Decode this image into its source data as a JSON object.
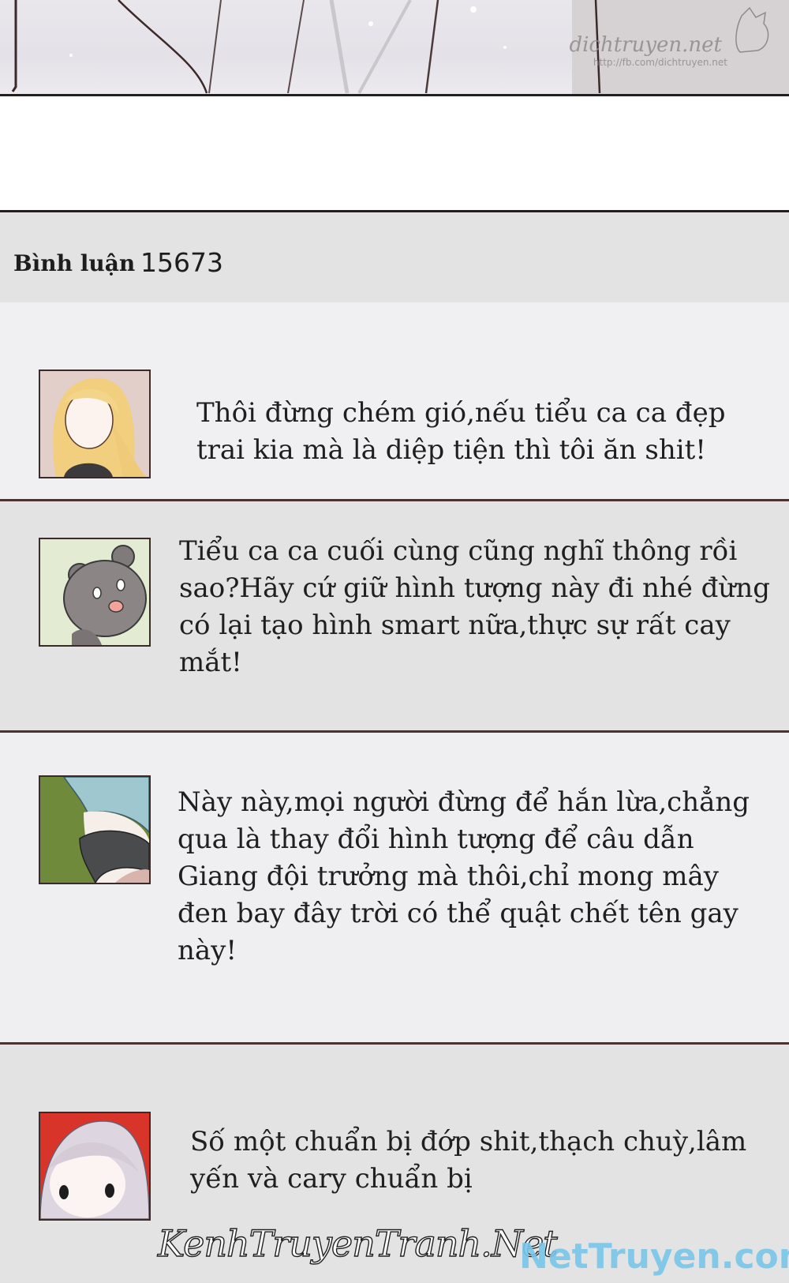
{
  "top_panel": {
    "watermark_title": "dichtruyen.net",
    "watermark_url": "http://fb.com/dichtruyen.net"
  },
  "comments_header": {
    "label": "Bình luận",
    "count": "15673"
  },
  "comments": [
    {
      "avatar_icon": "blonde-girl-avatar-icon",
      "text": "Thôi đừng chém gió,nếu tiểu ca ca đẹp trai kia mà là diệp tiện thì tôi ăn shit!"
    },
    {
      "avatar_icon": "bear-avatar-icon",
      "text": "Tiểu ca ca cuối cùng cũng nghĩ thông rồi sao?Hãy cứ giữ hình tượng này đi nhé đừng có lại tạo hình smart nữa,thực sự rất cay mắt!"
    },
    {
      "avatar_icon": "blue-hair-scarf-avatar-icon",
      "text": "Này này,mọi người đừng để hắn lừa,chẳng qua là thay đổi hình tượng để câu dẫn Giang đội trưởng mà thôi,chỉ mong mây đen bay đây trời có thể quật chết tên gay này!"
    },
    {
      "avatar_icon": "silver-hair-girl-avatar-icon",
      "text": "Số một chuẩn bị đớp shit,thạch chuỳ,lâm yến và cary chuẩn bị"
    }
  ],
  "footer": {
    "watermark_left": "KenhTruyenTranh.Net",
    "watermark_right": "NetTruyen.com"
  },
  "colors": {
    "panel_border": "#231f1f",
    "divider": "#4a3232",
    "background": "#e3e2e2"
  }
}
